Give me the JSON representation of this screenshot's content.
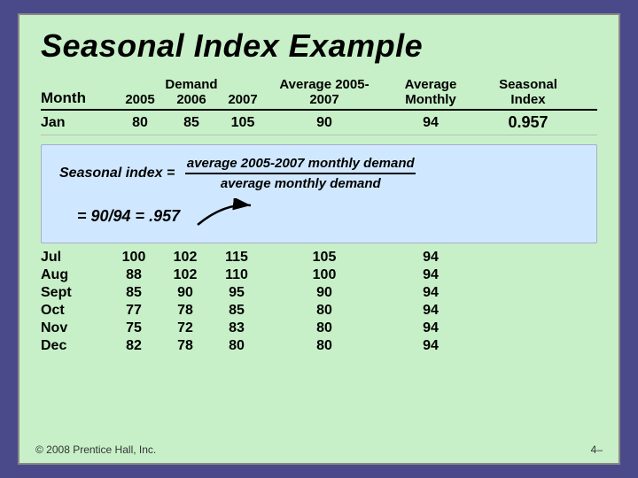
{
  "title": "Seasonal Index Example",
  "table": {
    "headers": {
      "month": "Month",
      "demand_label": "Demand",
      "year1": "2005",
      "year2": "2006",
      "year3": "2007",
      "avg_2005_2007": "Average 2005-2007",
      "avg_monthly": "Average Monthly",
      "seasonal_index": "Seasonal Index"
    },
    "jan_row": {
      "month": "Jan",
      "y2005": "80",
      "y2006": "85",
      "y2007": "105",
      "avg": "90",
      "avg_monthly": "94",
      "seasonal": "0.957"
    },
    "bottom_rows": [
      {
        "month": "Jul",
        "y2005": "100",
        "y2006": "102",
        "y2007": "115",
        "avg": "105",
        "avg_monthly": "94"
      },
      {
        "month": "Aug",
        "y2005": "88",
        "y2006": "102",
        "y2007": "110",
        "avg": "100",
        "avg_monthly": "94"
      },
      {
        "month": "Sept",
        "y2005": "85",
        "y2006": "90",
        "y2007": "95",
        "avg": "90",
        "avg_monthly": "94"
      },
      {
        "month": "Oct",
        "y2005": "77",
        "y2006": "78",
        "y2007": "85",
        "avg": "80",
        "avg_monthly": "94"
      },
      {
        "month": "Nov",
        "y2005": "75",
        "y2006": "72",
        "y2007": "83",
        "avg": "80",
        "avg_monthly": "94"
      },
      {
        "month": "Dec",
        "y2005": "82",
        "y2006": "78",
        "y2007": "80",
        "avg": "80",
        "avg_monthly": "94"
      }
    ]
  },
  "formula": {
    "label": "Seasonal index =",
    "numerator": "average 2005-2007 monthly demand",
    "denominator": "average monthly demand",
    "result": "= 90/94 = .957"
  },
  "footer": {
    "copyright": "© 2008 Prentice Hall, Inc.",
    "page": "4–"
  }
}
